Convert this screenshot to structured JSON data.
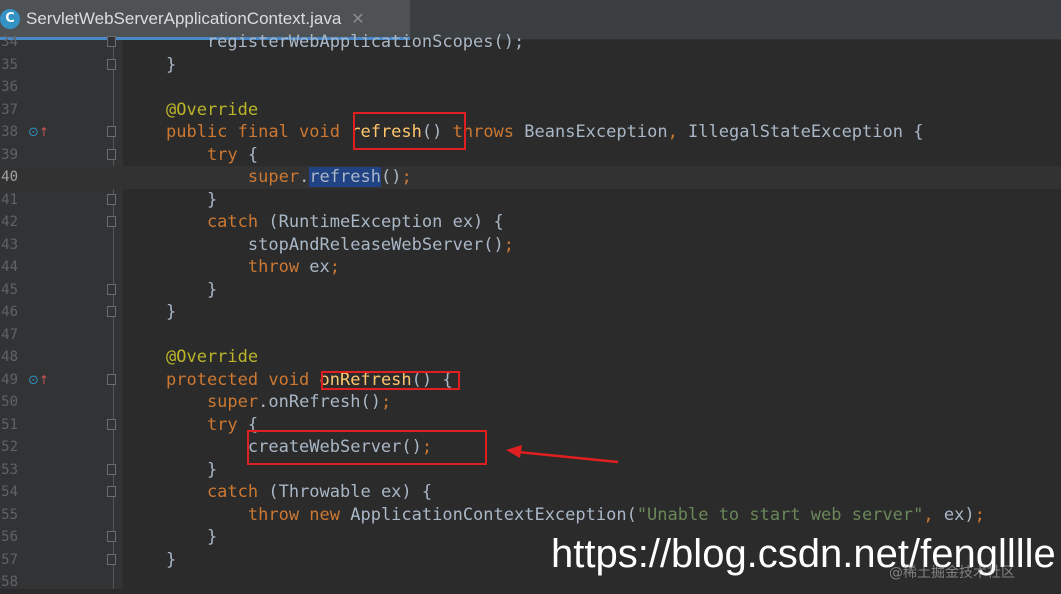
{
  "tab": {
    "file_icon_letter": "C",
    "filename": "ServletWebServerApplicationContext.java",
    "close_glyph": "✕"
  },
  "colors": {
    "keyword": "#cc7832",
    "annotation": "#bbb529",
    "method": "#ffc66d",
    "string": "#6a8759",
    "plain": "#a9b7c6",
    "highlight_box": "#e02020"
  },
  "lines": [
    {
      "n": "34",
      "fold": true,
      "tokens": [
        {
          "t": "    registerWebApplicationScopes();",
          "c": "plain"
        }
      ]
    },
    {
      "n": "35",
      "fold": true,
      "tokens": [
        {
          "t": "}",
          "c": "plain"
        }
      ]
    },
    {
      "n": "36",
      "tokens": []
    },
    {
      "n": "37",
      "tokens": [
        {
          "t": "@Override",
          "c": "ann"
        }
      ]
    },
    {
      "n": "38",
      "marker": true,
      "fold": true,
      "tokens": [
        {
          "t": "public final void ",
          "c": "kw"
        },
        {
          "t": "refresh",
          "c": "fn"
        },
        {
          "t": "() ",
          "c": "plain"
        },
        {
          "t": "throws ",
          "c": "kw"
        },
        {
          "t": "BeansException",
          "c": "plain"
        },
        {
          "t": ", ",
          "c": "kw"
        },
        {
          "t": "IllegalStateException {",
          "c": "plain"
        }
      ]
    },
    {
      "n": "39",
      "fold": true,
      "tokens": [
        {
          "t": "    try ",
          "c": "kw"
        },
        {
          "t": "{",
          "c": "plain"
        }
      ]
    },
    {
      "n": "40",
      "current": true,
      "tokens": [
        {
          "t": "        super",
          "c": "kw"
        },
        {
          "t": ".",
          "c": "plain"
        },
        {
          "t": "refresh",
          "c": "plain",
          "sel": true
        },
        {
          "t": "()",
          "c": "plain"
        },
        {
          "t": ";",
          "c": "kw"
        }
      ]
    },
    {
      "n": "41",
      "fold": true,
      "tokens": [
        {
          "t": "    }",
          "c": "plain"
        }
      ]
    },
    {
      "n": "42",
      "fold": true,
      "tokens": [
        {
          "t": "    catch ",
          "c": "kw"
        },
        {
          "t": "(RuntimeException ex) {",
          "c": "plain"
        }
      ]
    },
    {
      "n": "43",
      "tokens": [
        {
          "t": "        stopAndReleaseWebServer()",
          "c": "plain"
        },
        {
          "t": ";",
          "c": "kw"
        }
      ]
    },
    {
      "n": "44",
      "tokens": [
        {
          "t": "        throw ",
          "c": "kw"
        },
        {
          "t": "ex",
          "c": "plain"
        },
        {
          "t": ";",
          "c": "kw"
        }
      ]
    },
    {
      "n": "45",
      "fold": true,
      "tokens": [
        {
          "t": "    }",
          "c": "plain"
        }
      ]
    },
    {
      "n": "46",
      "fold": true,
      "tokens": [
        {
          "t": "}",
          "c": "plain"
        }
      ]
    },
    {
      "n": "47",
      "tokens": []
    },
    {
      "n": "48",
      "tokens": [
        {
          "t": "@Override",
          "c": "ann"
        }
      ]
    },
    {
      "n": "49",
      "marker": true,
      "fold": true,
      "tokens": [
        {
          "t": "protected void ",
          "c": "kw"
        },
        {
          "t": "onRefresh",
          "c": "fn"
        },
        {
          "t": "() {",
          "c": "plain"
        }
      ]
    },
    {
      "n": "50",
      "tokens": [
        {
          "t": "    super",
          "c": "kw"
        },
        {
          "t": ".onRefresh()",
          "c": "plain"
        },
        {
          "t": ";",
          "c": "kw"
        }
      ]
    },
    {
      "n": "51",
      "fold": true,
      "tokens": [
        {
          "t": "    try ",
          "c": "kw"
        },
        {
          "t": "{",
          "c": "plain"
        }
      ]
    },
    {
      "n": "52",
      "tokens": [
        {
          "t": "        createWebServer()",
          "c": "plain"
        },
        {
          "t": ";",
          "c": "kw"
        }
      ]
    },
    {
      "n": "53",
      "fold": true,
      "tokens": [
        {
          "t": "    }",
          "c": "plain"
        }
      ]
    },
    {
      "n": "54",
      "fold": true,
      "tokens": [
        {
          "t": "    catch ",
          "c": "kw"
        },
        {
          "t": "(Throwable ex) {",
          "c": "plain"
        }
      ]
    },
    {
      "n": "55",
      "tokens": [
        {
          "t": "        throw new ",
          "c": "kw"
        },
        {
          "t": "ApplicationContextException(",
          "c": "plain"
        },
        {
          "t": "\"Unable to start web server\"",
          "c": "str"
        },
        {
          "t": ", ",
          "c": "kw"
        },
        {
          "t": "ex)",
          "c": "plain"
        },
        {
          "t": ";",
          "c": "kw"
        }
      ]
    },
    {
      "n": "56",
      "fold": true,
      "tokens": [
        {
          "t": "    }",
          "c": "plain"
        }
      ]
    },
    {
      "n": "57",
      "fold": true,
      "tokens": [
        {
          "t": "}",
          "c": "plain"
        }
      ]
    },
    {
      "n": "58",
      "tokens": []
    }
  ],
  "watermark": {
    "url": "https://blog.csdn.net/fenglllle",
    "small": "@稀土掘金技术社区"
  }
}
